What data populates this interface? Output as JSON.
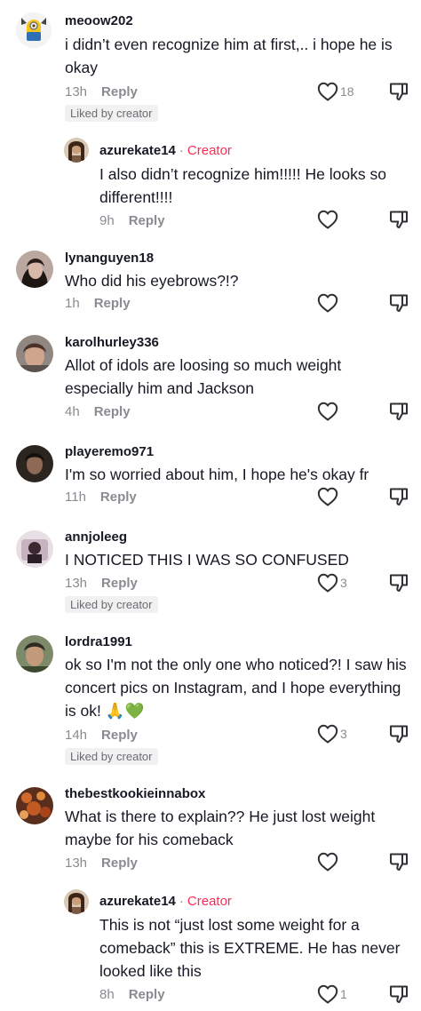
{
  "comments": [
    {
      "username": "meoow202",
      "text": "i didn’t even recognize him at first,.. i hope he is okay",
      "time": "13h",
      "reply": "Reply",
      "likes": "18",
      "liked_by_creator": "Liked by creator"
    },
    {
      "username": "azurekate14",
      "creator_label": "Creator",
      "text": "I also didn’t recognize him!!!!! He looks so different!!!!",
      "time": "9h",
      "reply": "Reply",
      "likes": ""
    },
    {
      "username": "lynanguyen18",
      "text": "Who did his eyebrows?!?",
      "time": "1h",
      "reply": "Reply",
      "likes": ""
    },
    {
      "username": "karolhurley336",
      "text": "Allot of idols are loosing so much weight especially him and Jackson",
      "time": "4h",
      "reply": "Reply",
      "likes": ""
    },
    {
      "username": "playeremo971",
      "text": "I'm so worried about him, I hope he's okay fr",
      "time": "11h",
      "reply": "Reply",
      "likes": ""
    },
    {
      "username": "annjoleeg",
      "text": "I NOTICED THIS I WAS SO CONFUSED",
      "time": "13h",
      "reply": "Reply",
      "likes": "3",
      "liked_by_creator": "Liked by creator"
    },
    {
      "username": "lordra1991",
      "text": "ok so I'm not the only one who noticed?! I saw his concert pics on Instagram, and I hope everything is ok! 🙏💚",
      "time": "14h",
      "reply": "Reply",
      "likes": "3",
      "liked_by_creator": "Liked by creator"
    },
    {
      "username": "thebestkookieinnabox",
      "text": "What is there to explain?? He just lost weight maybe for his comeback",
      "time": "13h",
      "reply": "Reply",
      "likes": ""
    },
    {
      "username": "azurekate14",
      "creator_label": "Creator",
      "text": "This is not “just lost some weight for a comeback” this is EXTREME. He has never looked like this",
      "time": "8h",
      "reply": "Reply",
      "likes": "1"
    }
  ],
  "icons": {
    "like": "heart-outline-icon",
    "dislike": "thumbs-down-icon"
  },
  "colors": {
    "creator": "#fe2c55",
    "muted": "#8a8b91",
    "text": "#161823",
    "badge_bg": "#f1f1f2"
  }
}
